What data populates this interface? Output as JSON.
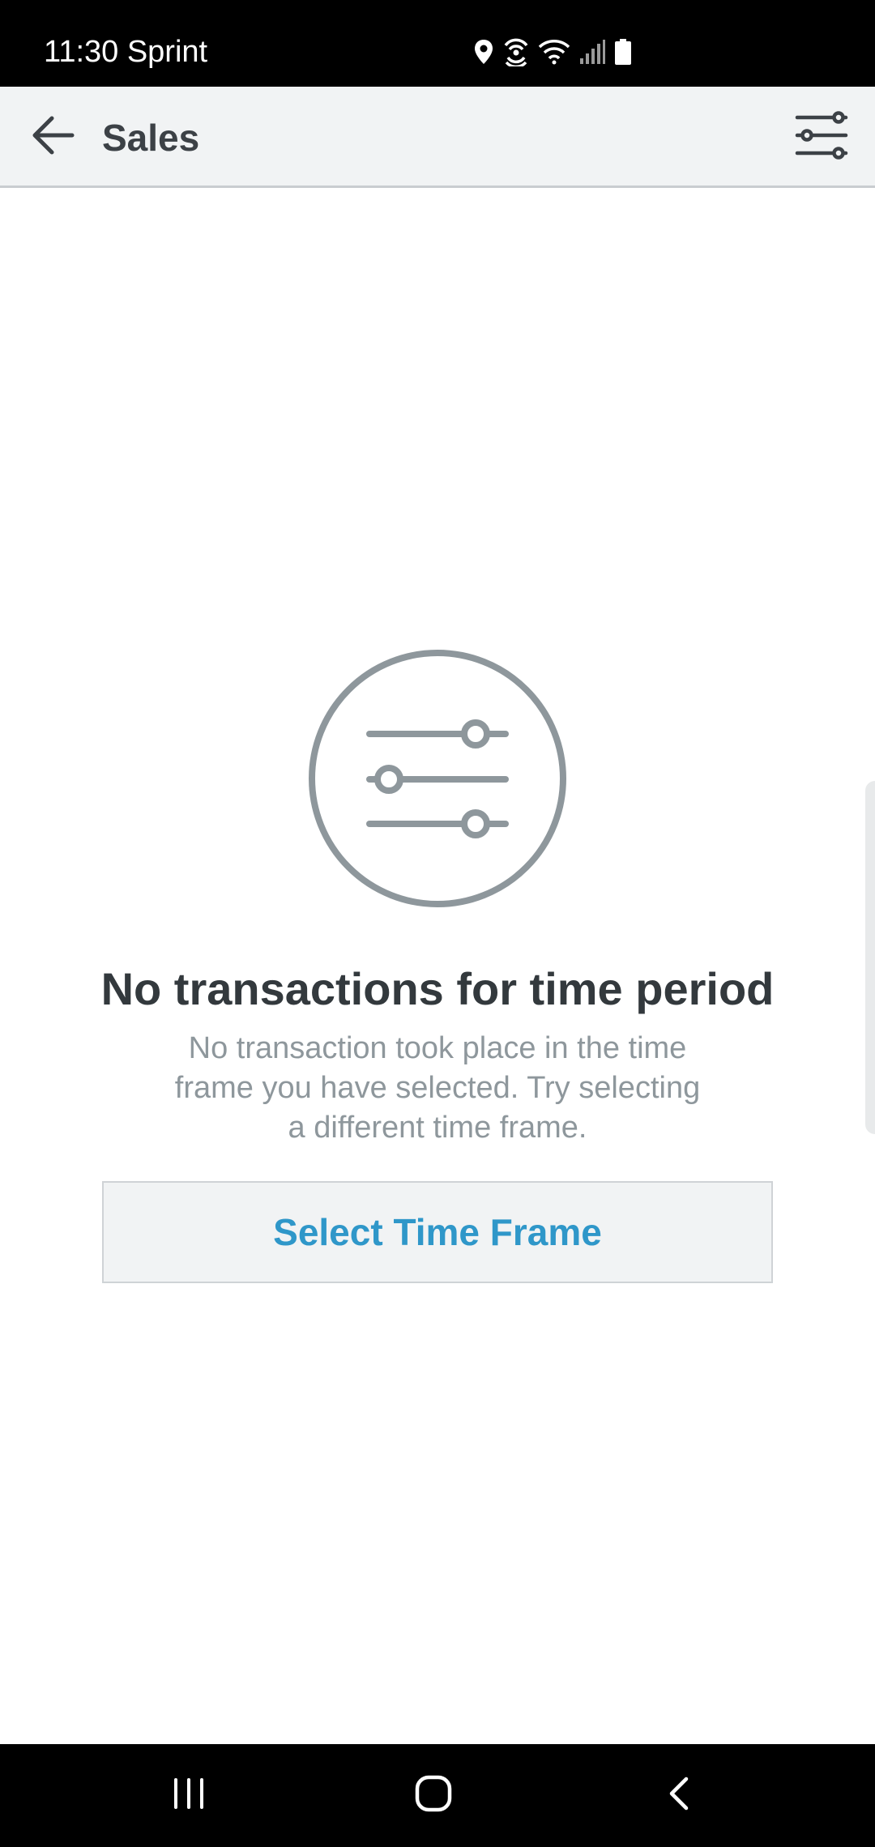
{
  "status_bar": {
    "time_carrier": "11:30 Sprint",
    "icons": [
      "location-icon",
      "hotspot-icon",
      "wifi-icon",
      "cell-signal-icon",
      "battery-icon"
    ]
  },
  "app_bar": {
    "title": "Sales",
    "back_icon": "arrow-left-icon",
    "filter_icon": "sliders-icon"
  },
  "empty_state": {
    "illustration_icon": "sliders-circle-icon",
    "title": "No transactions for time period",
    "message": "No transaction took place in the time frame you have selected. Try selecting a different time frame.",
    "button_label": "Select Time Frame"
  },
  "nav_bar": {
    "icons": [
      "recents-icon",
      "home-icon",
      "back-icon"
    ]
  },
  "colors": {
    "accent": "#2f97c9",
    "icon_gray": "#8e979c",
    "title_dark": "#33393d",
    "app_bar_bg": "#f1f3f4"
  }
}
